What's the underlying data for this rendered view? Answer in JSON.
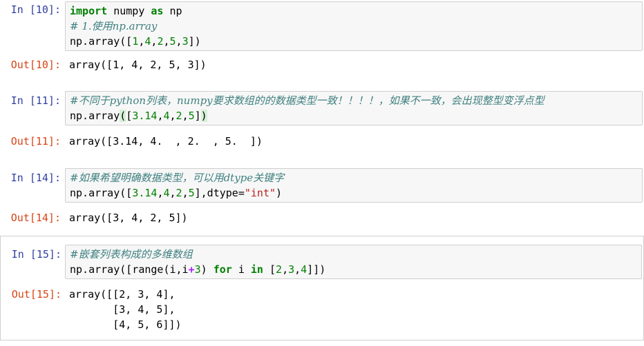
{
  "cells": [
    {
      "in_prompt": "In [10]:",
      "out_prompt": "Out[10]:",
      "code": {
        "l1_kw1": "import",
        "l1_t1": " numpy ",
        "l1_kw2": "as",
        "l1_t2": " np",
        "l2_comment": "# 1.使用np.array",
        "l3_a": "np.array([",
        "l3_n1": "1",
        "l3_c1": ",",
        "l3_n2": "4",
        "l3_c2": ",",
        "l3_n3": "2",
        "l3_c3": ",",
        "l3_n4": "5",
        "l3_c4": ",",
        "l3_n5": "3",
        "l3_b": "])"
      },
      "output": [
        "array([1, 4, 2, 5, 3])"
      ]
    },
    {
      "in_prompt": "In [11]:",
      "out_prompt": "Out[11]:",
      "code": {
        "l1_comment": "#不同于python列表，numpy要求数组的的数据类型一致！！！！，如果不一致，会出现整型变浮点型",
        "l2_a": "np.array",
        "l2_paren_open": "(",
        "l2_b": "[",
        "l2_n1": "3.14",
        "l2_c1": ",",
        "l2_n2": "4",
        "l2_c2": ",",
        "l2_n3": "2",
        "l2_c3": ",",
        "l2_n4": "5",
        "l2_d": "]",
        "l2_paren_close": ")"
      },
      "output": [
        "array([3.14, 4.  , 2.  , 5.  ])"
      ]
    },
    {
      "in_prompt": "In [14]:",
      "out_prompt": "Out[14]:",
      "code": {
        "l1_comment": "#如果希望明确数据类型，可以用dtype关键字",
        "l2_a": "np.array([",
        "l2_n1": "3.14",
        "l2_c1": ",",
        "l2_n2": "4",
        "l2_c2": ",",
        "l2_n3": "2",
        "l2_c3": ",",
        "l2_n4": "5",
        "l2_b": "],dtype=",
        "l2_str": "\"int\"",
        "l2_e": ")"
      },
      "output": [
        "array([3, 4, 2, 5])"
      ]
    },
    {
      "in_prompt": "In [15]:",
      "out_prompt": "Out[15]:",
      "code": {
        "l1_comment": "#嵌套列表构成的多维数组",
        "l2_a": "np.array([range(i,i",
        "l2_op": "+",
        "l2_n1": "3",
        "l2_b": ") ",
        "l2_kw1": "for",
        "l2_c": " i ",
        "l2_kw2": "in",
        "l2_d": " [",
        "l2_n2": "2",
        "l2_c1": ",",
        "l2_n3": "3",
        "l2_c2": ",",
        "l2_n4": "4",
        "l2_e": "]])"
      },
      "output": [
        "array([[2, 3, 4],",
        "       [3, 4, 5],",
        "       [4, 5, 6]])"
      ]
    }
  ]
}
